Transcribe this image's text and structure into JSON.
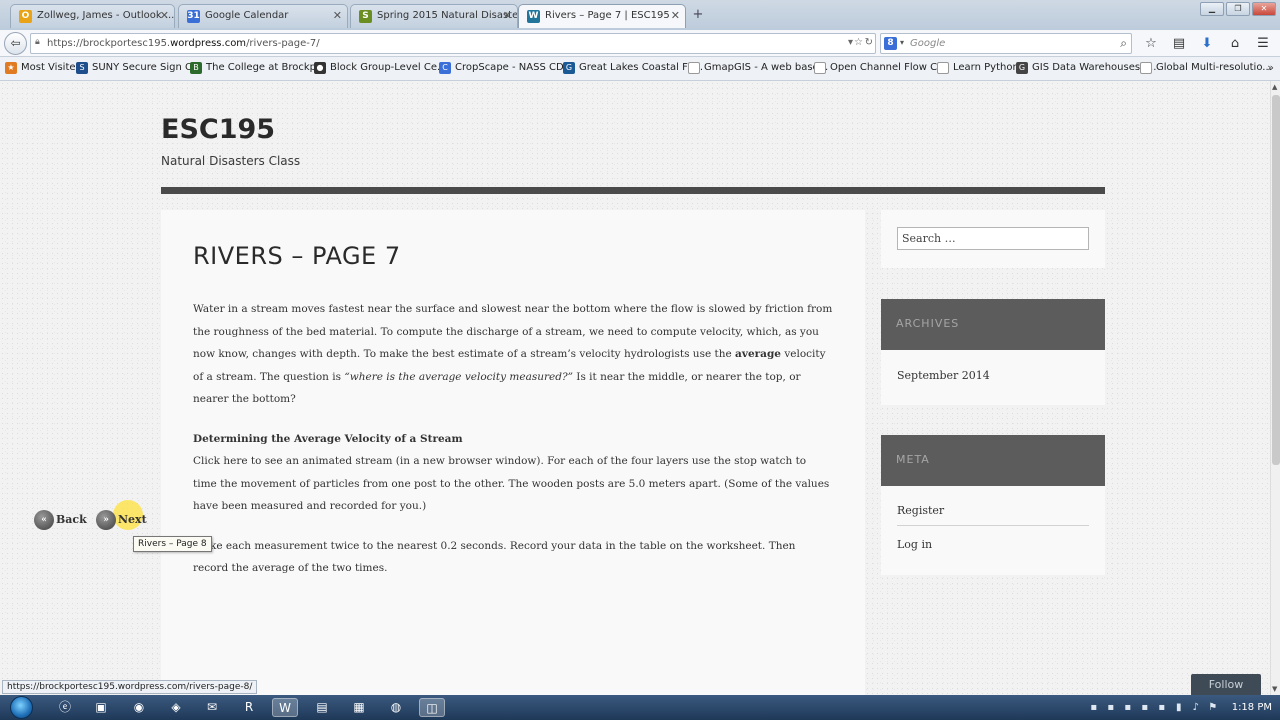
{
  "browser": {
    "tabs": [
      {
        "label": "Zollweg, James - Outlook ...",
        "icon": "O",
        "icon_color": "#e8a317"
      },
      {
        "label": "Google Calendar",
        "icon": "31",
        "icon_color": "#3b6fd8"
      },
      {
        "label": "Spring 2015 Natural Disaste...",
        "icon": "S",
        "icon_color": "#6b8e23"
      },
      {
        "label": "Rivers – Page 7 | ESC195",
        "icon": "W",
        "icon_color": "#21759b"
      }
    ],
    "url_prefix": "https://brockportesc195.",
    "url_domain": "wordpress.com",
    "url_path": "/rivers-page-7/",
    "search_placeholder": "Google"
  },
  "bookmarks": [
    {
      "label": "Most Visited",
      "color": "#e07b22",
      "icon": "★"
    },
    {
      "label": "SUNY Secure Sign On",
      "color": "#1f4e8c",
      "icon": "S"
    },
    {
      "label": "The College at Brockp...",
      "color": "#2d6b2d",
      "icon": "B"
    },
    {
      "label": "Block Group-Level Ce...",
      "color": "#333333",
      "icon": "●"
    },
    {
      "label": "CropScape - NASS CD...",
      "color": "#3b6fd8",
      "icon": "C"
    },
    {
      "label": "Great Lakes Coastal Fo...",
      "color": "#1c5a96",
      "icon": "G"
    },
    {
      "label": "GmapGIS - A web base...",
      "color": "#888888",
      "icon": ""
    },
    {
      "label": "Open Channel Flow C...",
      "color": "#888888",
      "icon": ""
    },
    {
      "label": "Learn Python",
      "color": "#888888",
      "icon": ""
    },
    {
      "label": "GIS Data Warehouses -...",
      "color": "#444444",
      "icon": "G"
    },
    {
      "label": "Global Multi-resolutio...",
      "color": "#888888",
      "icon": ""
    }
  ],
  "site": {
    "title": "ESC195",
    "description": "Natural Disasters Class"
  },
  "post": {
    "title": "RIVERS – PAGE 7",
    "p1_a": "Water in a stream moves fastest near the surface and slowest near the bottom where the flow is slowed by friction from the roughness of the bed material.  To compute the discharge of a stream, we need to compute velocity, which, as you now know, changes with depth. To make the best estimate of a stream’s velocity hydrologists use the ",
    "p1_bold": "average",
    "p1_b": " velocity of a stream.  The question is ",
    "p1_italic": "“where is the average velocity measured?”",
    "p1_c": " Is it near the middle, or nearer the top, or nearer the bottom?",
    "p2_heading": "Determining the Average Velocity of a Stream",
    "p2_a": "Click ",
    "p2_link": "here",
    "p2_b": " to see an animated stream (in a new browser window).  For each of the four layers use the stop watch to time the movement of particles from one post to the other. The wooden posts are 5.0 meters apart. (Some of the values have been measured and recorded for you.)",
    "p3": "Make each measurement twice to the nearest 0.2 seconds. Record your data in the table on the worksheet. Then record the average of the two times.",
    "back_label": "Back",
    "next_label": "Next",
    "tooltip": "Rivers – Page 8"
  },
  "sidebar": {
    "search_placeholder": "Search …",
    "archives_title": "ARCHIVES",
    "archives_items": [
      "September 2014"
    ],
    "meta_title": "META",
    "meta_items": [
      "Register",
      "Log in"
    ]
  },
  "follow_label": "Follow",
  "status_url": "https://brockportesc195.wordpress.com/rivers-page-8/",
  "clock": "1:18 PM"
}
